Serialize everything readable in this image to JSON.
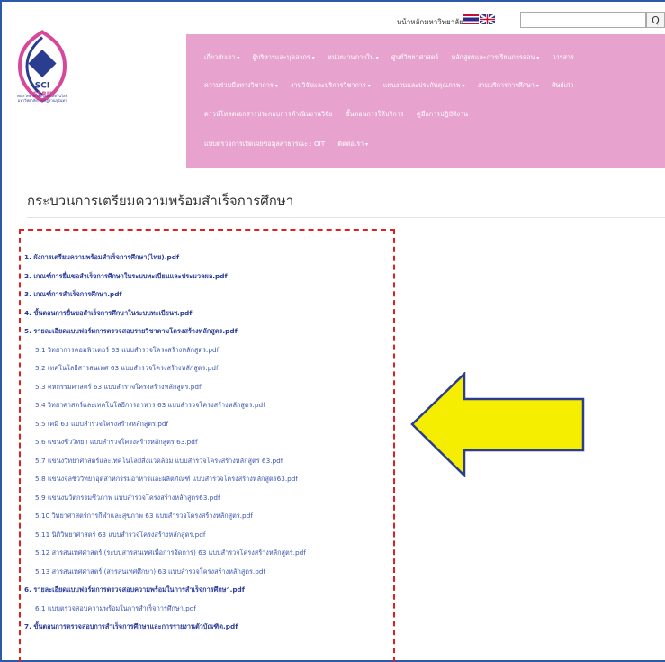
{
  "header": {
    "home_link": "หน้าหลักมหาวิทยาลัย",
    "search_placeholder": "",
    "search_button": "Q",
    "logo_label": "คณะวิทยาศาสตร์และเทคโนโลยี มหาวิทยาลัยราชภัฏสวนสุนันทา"
  },
  "menu": {
    "row1": [
      "เกี่ยวกับเรา",
      "ผู้บริหารและบุคลากร",
      "หน่วยงานภายใน",
      "ศูนย์วิทยาศาสตร์",
      "หลักสูตรและการเรียนการสอน",
      "วารสาร"
    ],
    "row2": [
      "ความร่วมมือทางวิชาการ",
      "งานวิจัยและบริการวิชาการ",
      "แผนงานและประกันคุณภาพ",
      "งานบริการการศึกษา",
      "ศิษย์เก่า"
    ],
    "row3": [
      "ดาวน์โหลดเอกสารประกอบการดำเนินงานวิจัย",
      "ขั้นตอนการให้บริการ",
      "คู่มือการปฏิบัติงาน"
    ],
    "row4": [
      "แบบตรวจการเปิดเผยข้อมูลสาธารณะ : OIT",
      "ติดต่อเรา"
    ]
  },
  "page": {
    "title": "กระบวนการเตรียมความพร้อมสำเร็จการศึกษา"
  },
  "documents": [
    {
      "label": "1. ผังการเตรียมความพร้อมสำเร็จการศึกษา(ไทย).pdf",
      "level": 0
    },
    {
      "label": "2. เกณฑ์การยื่นขอสำเร็จการศึกษาในระบบทะเบียนและประมวลผล.pdf",
      "level": 0
    },
    {
      "label": "3. เกณฑ์การสำเร็จการศึกษา.pdf",
      "level": 0
    },
    {
      "label": "4. ขั้นตอนการยื่นขอสำเร็จการศึกษาในระบบทะเบียนฯ.pdf",
      "level": 0
    },
    {
      "label": "5. รายละเอียดแบบฟอร์มการตรวจสอบรายวิชาตามโครงสร้างหลักสูตร.pdf",
      "level": 0
    },
    {
      "label": "5.1 วิทยาการคอมพิวเตอร์ 63 แบบสำรวจโครงสร้างหลักสูตร.pdf",
      "level": 1
    },
    {
      "label": "5.2 เทคโนโลยีสารสนเทศ 63 แบบสำรวจโครงสร้างหลักสูตร.pdf",
      "level": 1
    },
    {
      "label": "5.3 คหกรรมศาสตร์ 63 แบบสำรวจโครงสร้างหลักสูตร.pdf",
      "level": 1
    },
    {
      "label": "5.4 วิทยาศาสตร์และเทคโนโลยีการอาหาร 63 แบบสำรวจโครงสร้างหลักสูตร.pdf",
      "level": 1
    },
    {
      "label": "5.5 เคมี 63 แบบสำรวจโครงสร้างหลักสูตร.pdf",
      "level": 1
    },
    {
      "label": "5.6 แขนงชีววิทยา แบบสำรวจโครงสร้างหลักสูตร 63.pdf",
      "level": 1
    },
    {
      "label": "5.7 แขนงวิทยาศาสตร์และเทคโนโลยีสิ่งแวดล้อม แบบสำรวจโครงสร้างหลักสูตร 63.pdf",
      "level": 1
    },
    {
      "label": "5.8 แขนงจุลชีววิทยาอุตสาหกรรมอาหารและผลิตภัณฑ์ แบบสำรวจโครงสร้างหลักสูตร63.pdf",
      "level": 1
    },
    {
      "label": "5.9 แขนงนวัตกรรมชีวภาพ แบบสำรวจโครงสร้างหลักสูตร63.pdf",
      "level": 1
    },
    {
      "label": "5.10 วิทยาศาสตร์การกีฬาและสุขภาพ 63 แบบสำรวจโครงสร้างหลักสูตร.pdf",
      "level": 1
    },
    {
      "label": "5.11 นิติวิทยาศาสตร์ 63 แบบสำรวจโครงสร้างหลักสูตร.pdf",
      "level": 1
    },
    {
      "label": "5.12 สารสนเทศศาสตร์ (ระบบสารสนเทศเพื่อการจัดการ) 63 แบบสำรวจโครงสร้างหลักสูตร.pdf",
      "level": 1
    },
    {
      "label": "5.13 สารสนเทศศาสตร์ (สารสนเทศศึกษา) 63 แบบสำรวจโครงสร้างหลักสูตร.pdf",
      "level": 1
    },
    {
      "label": "6. รายละเอียดแบบฟอร์มการตรวจสอบความพร้อมในการสำเร็จการศึกษา.pdf",
      "level": 0
    },
    {
      "label": "6.1 แบบตรวจสอบความพร้อมในการสำเร็จการศึกษา.pdf",
      "level": 1
    },
    {
      "label": "7. ขั้นตอนการตรวจสอบการสำเร็จการศึกษาและการรายงานตัวบัณฑิต.pdf",
      "level": 0
    }
  ],
  "colors": {
    "menu_bg": "#e7a2cd",
    "link": "#2a3d9a",
    "annotation_border": "#e02020",
    "arrow_fill": "#f5ee00"
  },
  "icons": [
    "logo-emblem-icon",
    "thai-flag-icon",
    "uk-flag-icon",
    "search-icon",
    "yellow-arrow-icon"
  ]
}
